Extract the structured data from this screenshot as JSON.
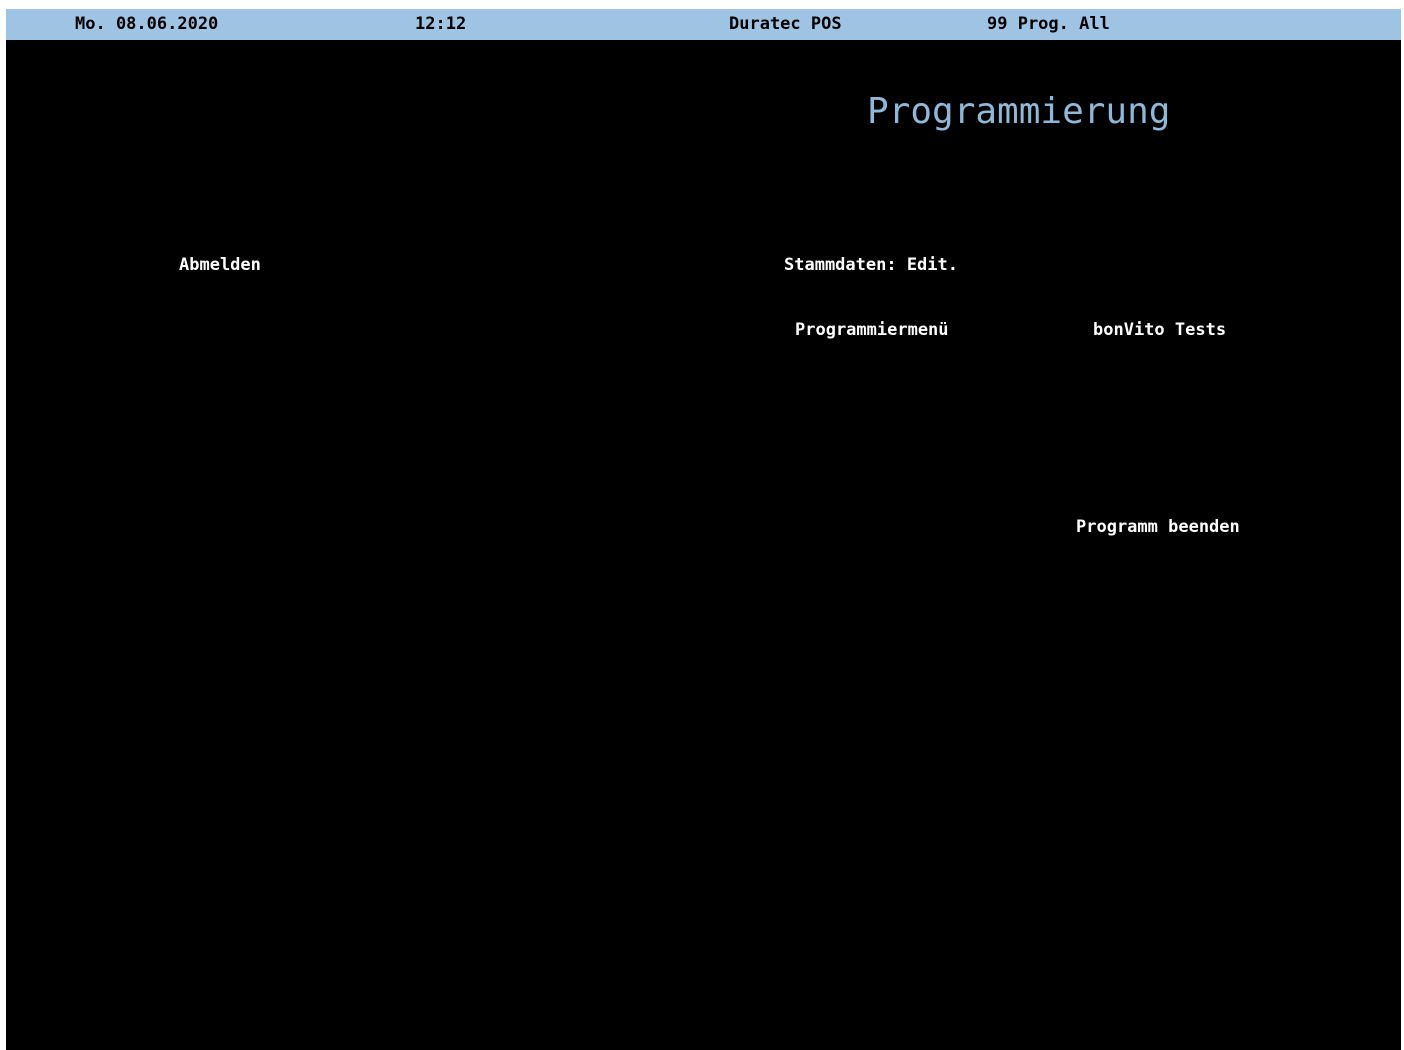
{
  "status_bar": {
    "date": "Mo. 08.06.2020",
    "time": "12:12",
    "product": "Duratec POS",
    "user": "99  Prog. All"
  },
  "main": {
    "title": "Programmierung",
    "buttons": {
      "abmelden": "Abmelden",
      "stammdaten_edit": "Stammdaten: Edit.",
      "programmiermenu": "Programmiermenü",
      "bonvito_tests": "bonVito Tests",
      "programm_beenden": "Programm beenden"
    }
  },
  "colors": {
    "status_bar_background": "#9ec3e3",
    "screen_background": "#000000",
    "title_text": "#8fb7d8",
    "button_text": "#ffffff"
  }
}
